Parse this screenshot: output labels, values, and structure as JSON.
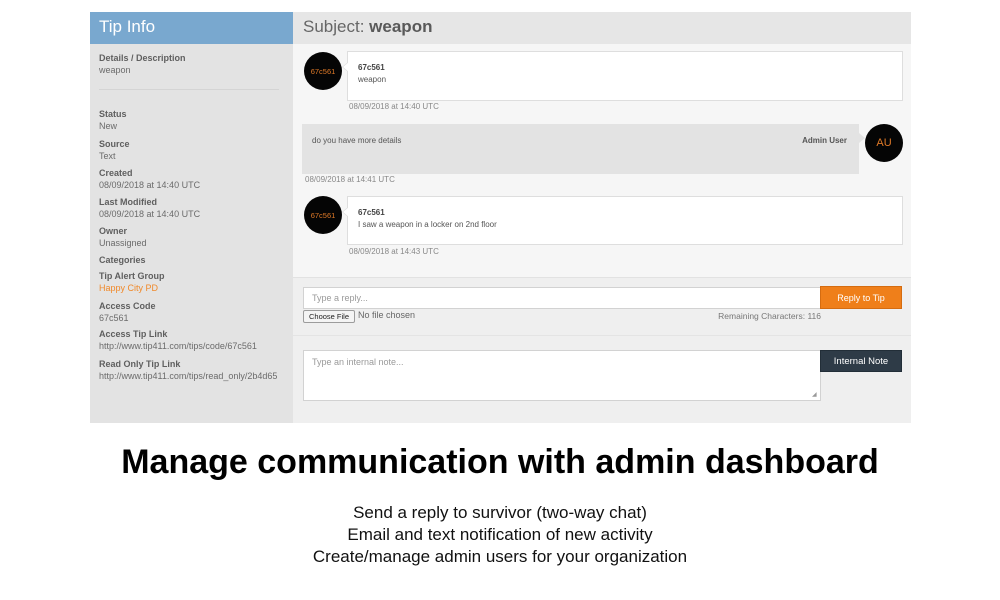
{
  "sidebar": {
    "title": "Tip Info",
    "details_label": "Details / Description",
    "details_value": "weapon",
    "status_label": "Status",
    "status_value": "New",
    "source_label": "Source",
    "source_value": "Text",
    "created_label": "Created",
    "created_value": "08/09/2018 at 14:40 UTC",
    "modified_label": "Last Modified",
    "modified_value": "08/09/2018 at 14:40 UTC",
    "owner_label": "Owner",
    "owner_value": "Unassigned",
    "categories_label": "Categories",
    "alert_group_label": "Tip Alert Group",
    "alert_group_value": "Happy City PD",
    "access_code_label": "Access Code",
    "access_code_value": "67c561",
    "access_link_label": "Access Tip Link",
    "access_link_value": "http://www.tip411.com/tips/code/67c561",
    "readonly_link_label": "Read Only Tip Link",
    "readonly_link_value": "http://www.tip411.com/tips/read_only/2b4d65"
  },
  "subject": {
    "prefix": "Subject:",
    "value": "weapon"
  },
  "messages": [
    {
      "avatar": "67c561",
      "sender": "67c561",
      "text": "weapon",
      "timestamp": "08/09/2018 at 14:40 UTC"
    },
    {
      "avatar": "AU",
      "sender": "Admin User",
      "text": "do you have more details",
      "timestamp": "08/09/2018 at 14:41 UTC"
    },
    {
      "avatar": "67c561",
      "sender": "67c561",
      "text": "I saw a weapon in a locker on 2nd floor",
      "timestamp": "08/09/2018 at 14:43 UTC"
    }
  ],
  "reply": {
    "placeholder": "Type a reply...",
    "button": "Reply to Tip",
    "file_button": "Choose File",
    "file_status": "No file chosen",
    "remaining": "Remaining Characters: 116"
  },
  "note": {
    "placeholder": "Type an internal note...",
    "button": "Internal Note"
  },
  "caption": {
    "headline": "Manage communication with admin dashboard",
    "line1": "Send a reply to survivor (two-way chat)",
    "line2": "Email and text notification of new activity",
    "line3": "Create/manage admin users for your organization"
  },
  "colors": {
    "sidebar_header": "#79a8cf",
    "accent_orange": "#ef7f1a",
    "dark_button": "#2e3b47"
  }
}
